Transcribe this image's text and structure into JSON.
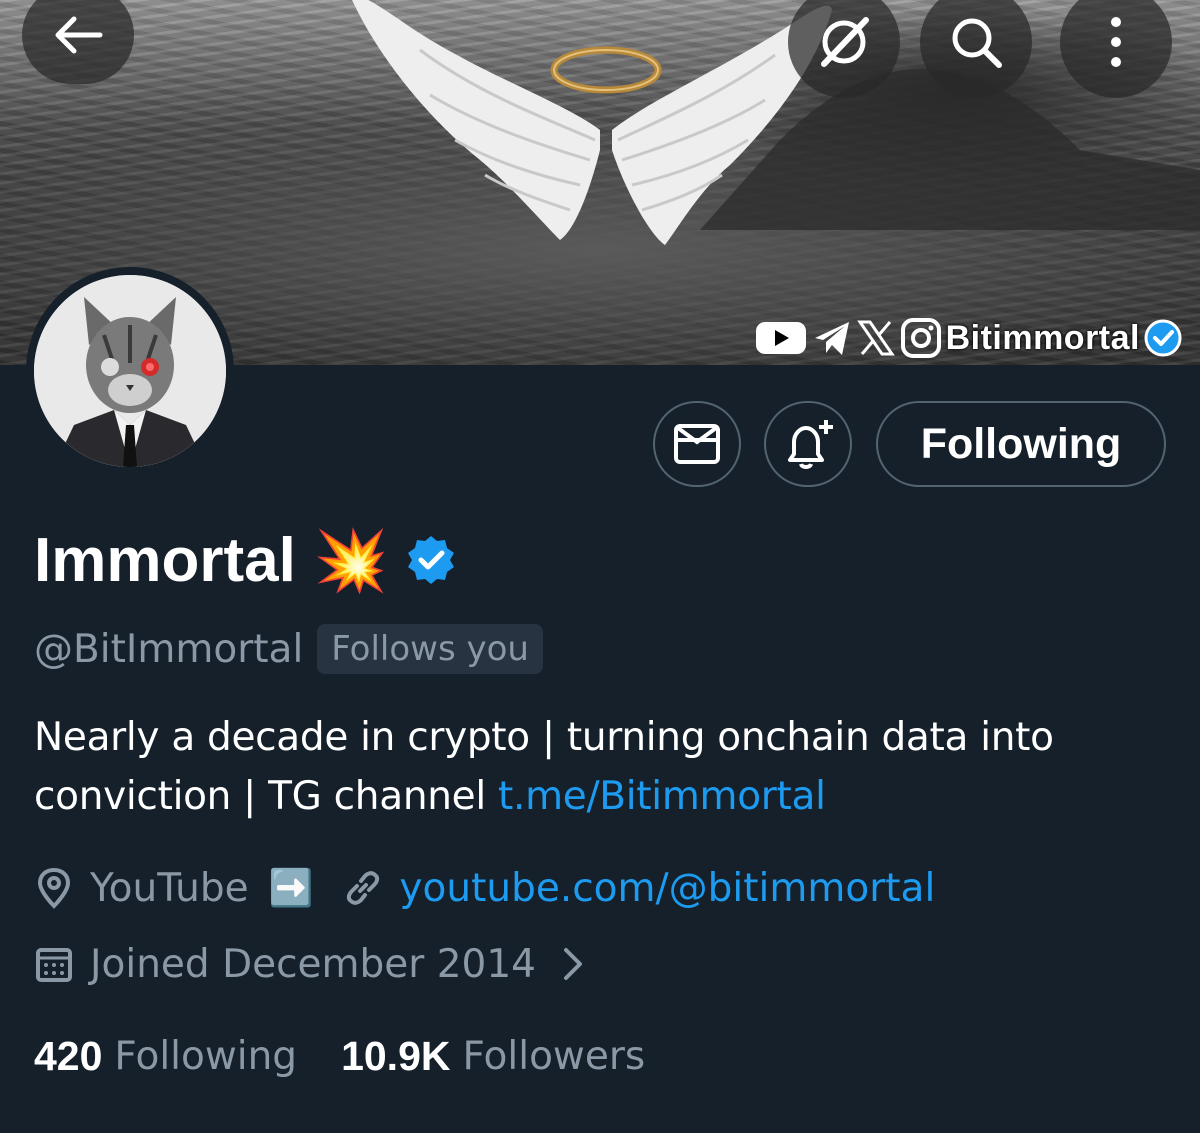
{
  "banner": {
    "brand_text": "Bitimmortal",
    "icons": [
      "youtube-icon",
      "telegram-icon",
      "x-icon",
      "instagram-icon",
      "verified-badge-icon"
    ]
  },
  "toolbar": {
    "back_icon": "arrow-left-icon",
    "grok_icon": "grok-icon",
    "search_icon": "search-icon",
    "more_icon": "more-vertical-icon"
  },
  "actions": {
    "message_icon": "envelope-icon",
    "notify_icon": "bell-plus-icon",
    "follow_label": "Following"
  },
  "profile": {
    "display_name": "Immortal",
    "name_emoji": "💥",
    "handle": "@BitImmortal",
    "follows_you": "Follows you",
    "bio_line1": "Nearly a decade in crypto | turning onchain data into",
    "bio_line2_prefix": "conviction | TG channel ",
    "bio_link": "t.me/Bitimmortal",
    "location": "YouTube",
    "location_emoji": "➡️",
    "website": "youtube.com/@bitimmortal",
    "joined": "Joined December 2014"
  },
  "stats": {
    "following_count": "420",
    "following_label": "Following",
    "followers_count": "10.9K",
    "followers_label": "Followers"
  },
  "colors": {
    "background": "#15202b",
    "accent": "#1d9bf0",
    "muted_text": "#8b98a5",
    "border": "#536471"
  }
}
